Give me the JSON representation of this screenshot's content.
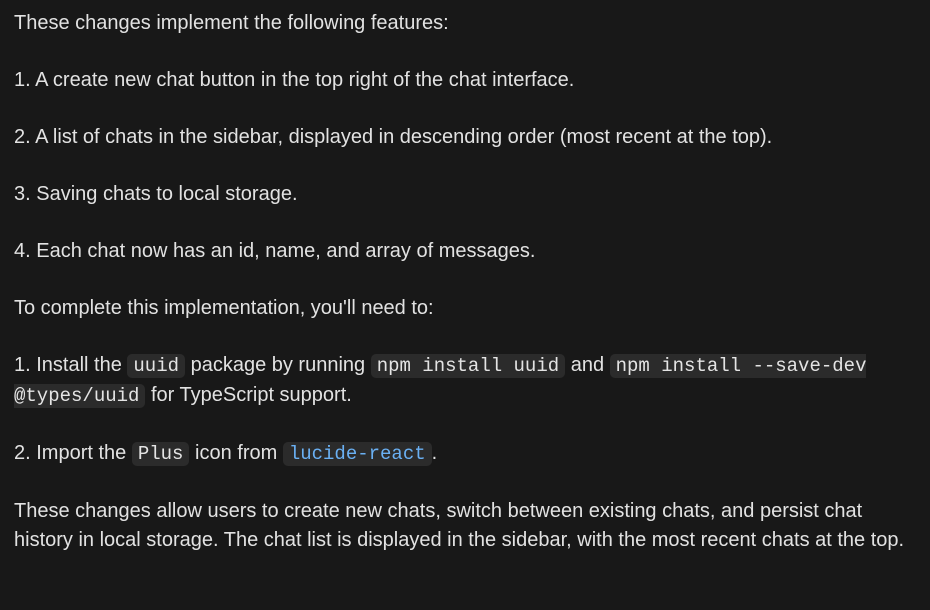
{
  "message": {
    "intro": "These changes implement the following features:",
    "features": [
      "1. A create new chat button in the top right of the chat interface.",
      "2. A list of chats in the sidebar, displayed in descending order (most recent at the top).",
      "3. Saving chats to local storage.",
      "4. Each chat now has an id, name, and array of messages."
    ],
    "todo_intro": "To complete this implementation, you'll need to:",
    "step1": {
      "a": "1. Install the ",
      "code1": "uuid",
      "b": " package by running ",
      "code2": "npm install uuid",
      "c": " and ",
      "code3": "npm install --save-dev @types/uuid",
      "d": " for TypeScript support."
    },
    "step2": {
      "a": "2. Import the ",
      "code1": "Plus",
      "b": " icon from ",
      "code2": "lucide-react",
      "c": "."
    },
    "summary": "These changes allow users to create new chats, switch between existing chats, and persist chat history in local storage. The chat list is displayed in the sidebar, with the most recent chats at the top."
  },
  "colors": {
    "background": "#181818",
    "text": "#e2e2e2",
    "code_bg": "#2b2b2b",
    "link": "#6ab0f3"
  }
}
